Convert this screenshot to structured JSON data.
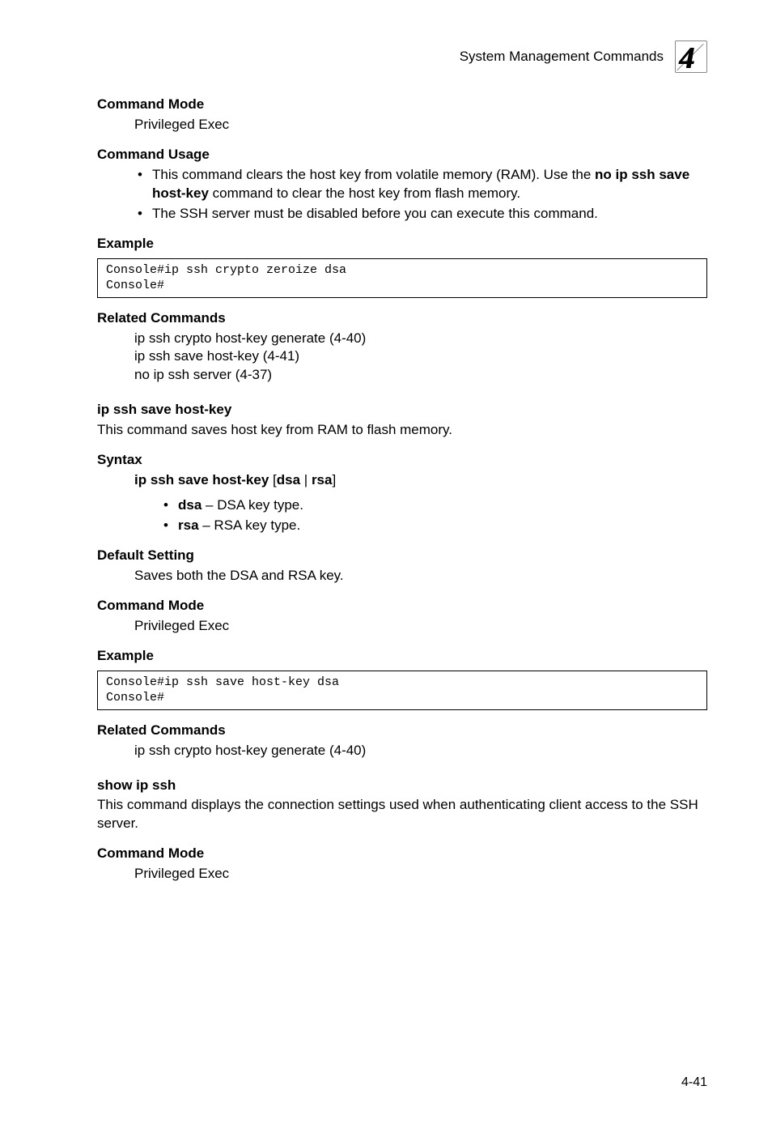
{
  "header": {
    "title": "System Management Commands",
    "chapter": "4"
  },
  "s1": {
    "hdr": "Command Mode",
    "body": "Privileged Exec"
  },
  "s2": {
    "hdr": "Command Usage",
    "b1a": "This command clears the host key from volatile memory (RAM). Use the ",
    "b1b": "no ip ssh save host-key",
    "b1c": " command to clear the host key from flash memory.",
    "b2": "The SSH server must be disabled before you can execute this command."
  },
  "s3": {
    "hdr": "Example",
    "code": "Console#ip ssh crypto zeroize dsa\nConsole#"
  },
  "s4": {
    "hdr": "Related Commands",
    "l1": "ip ssh crypto host-key generate (4-40)",
    "l2": "ip ssh save host-key (4-41)",
    "l3": "no ip ssh server (4-37)"
  },
  "cmd1": {
    "title": "ip ssh save host-key",
    "desc": "This command saves host key from RAM to flash memory."
  },
  "s5": {
    "hdr": "Syntax",
    "syn_a": "ip ssh save host-key",
    "syn_b": " [",
    "syn_c": "dsa",
    "syn_d": " | ",
    "syn_e": "rsa",
    "syn_f": "]",
    "o1a": "dsa",
    "o1b": " – DSA key type.",
    "o2a": "rsa",
    "o2b": " – RSA key type."
  },
  "s6": {
    "hdr": "Default Setting",
    "body": "Saves both the DSA and RSA key."
  },
  "s7": {
    "hdr": "Command Mode",
    "body": "Privileged Exec"
  },
  "s8": {
    "hdr": "Example",
    "code": "Console#ip ssh save host-key dsa\nConsole#"
  },
  "s9": {
    "hdr": "Related Commands",
    "l1": "ip ssh crypto host-key generate (4-40)"
  },
  "cmd2": {
    "title": "show ip ssh",
    "desc": "This command displays the connection settings used when authenticating client access to the SSH server."
  },
  "s10": {
    "hdr": "Command Mode",
    "body": "Privileged Exec"
  },
  "footer": {
    "page": "4-41"
  }
}
